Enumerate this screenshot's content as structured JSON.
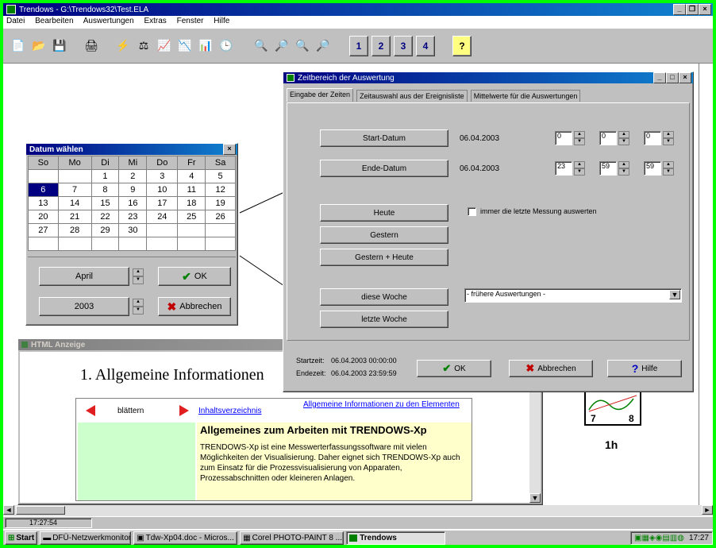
{
  "app": {
    "title": "Trendows - G:\\Trendows32\\Test.ELA",
    "menu": [
      "Datei",
      "Bearbeiten",
      "Auswertungen",
      "Extras",
      "Fenster",
      "Hilfe"
    ],
    "toolbar_numbers": [
      "1",
      "2",
      "3",
      "4"
    ],
    "toolbar_help": "?",
    "status_time": "17:27:54"
  },
  "calendar": {
    "title": "Datum wählen",
    "weekdays": [
      "So",
      "Mo",
      "Di",
      "Mi",
      "Do",
      "Fr",
      "Sa"
    ],
    "rows": [
      [
        "",
        "",
        "1",
        "2",
        "3",
        "4",
        "5"
      ],
      [
        "6",
        "7",
        "8",
        "9",
        "10",
        "11",
        "12"
      ],
      [
        "13",
        "14",
        "15",
        "16",
        "17",
        "18",
        "19"
      ],
      [
        "20",
        "21",
        "22",
        "23",
        "24",
        "25",
        "26"
      ],
      [
        "27",
        "28",
        "29",
        "30",
        "",
        "",
        ""
      ],
      [
        "",
        "",
        "",
        "",
        "",
        "",
        ""
      ]
    ],
    "selected": "6",
    "month": "April",
    "year": "2003",
    "ok": "OK",
    "cancel": "Abbrechen"
  },
  "dialog": {
    "title": "Zeitbereich der Auswertung",
    "tabs": [
      "Eingabe der Zeiten",
      "Zeitauswahl aus der Ereignisliste",
      "Mittelwerte für die Auswertungen"
    ],
    "start_button": "Start-Datum",
    "start_date": "06.04.2003",
    "start_time": [
      "0",
      "0",
      "0"
    ],
    "end_button": "Ende-Datum",
    "end_date": "06.04.2003",
    "end_time": [
      "23",
      "59",
      "59"
    ],
    "today": "Heute",
    "checkbox_label": "immer die letzte Messung auswerten",
    "yesterday": "Gestern",
    "yesterday_today": "Gestern + Heute",
    "this_week": "diese Woche",
    "last_week": "letzte Woche",
    "earlier": "- frühere Auswertungen -",
    "startzeit_label": "Startzeit:",
    "startzeit_value": "06.04.2003  00:00:00",
    "endezeit_label": "Endezeit:",
    "endezeit_value": "06.04.2003  23:59:59",
    "ok": "OK",
    "cancel": "Abbrechen",
    "help": "Hilfe"
  },
  "html_panel": {
    "title": "HTML Anzeige",
    "heading": "1. Allgemeine Informationen",
    "browse": "blättern",
    "toc_link": "Inhaltsverzeichnis",
    "info_link": "Allgemeine Informationen zu den Elementen",
    "content_title": "Allgemeines zum Arbeiten mit TRENDOWS-Xp",
    "content_text": "TRENDOWS-Xp ist eine Messwerterfassungssoftware mit vielen Möglichkeiten der Visualisierung. Daher eignet sich TRENDOWS-Xp auch zum Einsatz für die Prozessvisualisierung von Apparaten, Prozessabschnitten oder kleineren Anlagen."
  },
  "thumb": {
    "left": "7",
    "right": "8",
    "label": "1h"
  },
  "taskbar": {
    "start": "Start",
    "items": [
      "DFÜ-Netzwerkmonitor",
      "Tdw-Xp04.doc - Micros...",
      "Corel PHOTO-PAINT 8 ...",
      "Trendows"
    ],
    "clock": "17:27"
  },
  "colors": {
    "border_green": "#00ff00",
    "title_blue": "#000080",
    "selected_day": "#000080",
    "content_bg": "#ffffcc",
    "left_cell": "#ccffcc"
  }
}
